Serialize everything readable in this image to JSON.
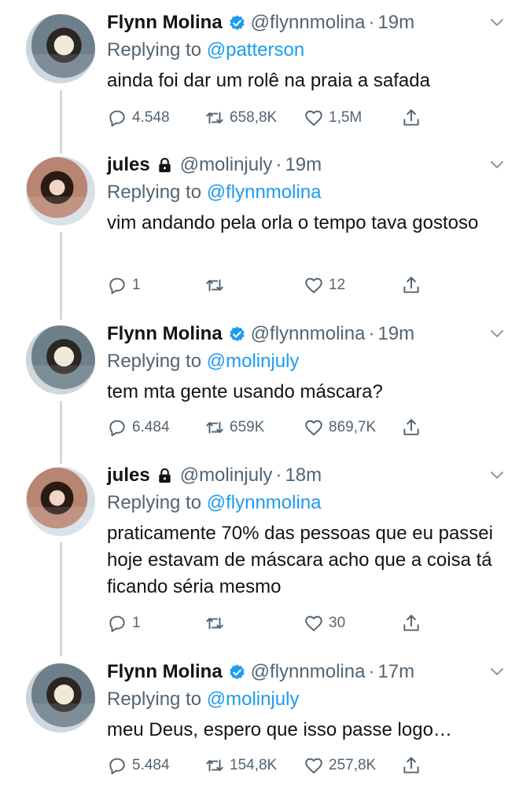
{
  "colors": {
    "accent": "#1d9bf0",
    "text_primary": "#0f1419",
    "text_secondary": "#536471",
    "thread_line": "#cfd9de"
  },
  "tweets": [
    {
      "author_name": "Flynn Molina",
      "verified": true,
      "locked": false,
      "handle": "@flynnmolina",
      "time": "19m",
      "reply_prefix": "Replying to ",
      "reply_to": "@patterson",
      "text": "ainda foi dar um rolê na praia a safada",
      "replies": "4.548",
      "retweets": "658,8K",
      "likes": "1,5M"
    },
    {
      "author_name": "jules",
      "verified": false,
      "locked": true,
      "handle": "@molinjuly",
      "time": "19m",
      "reply_prefix": "Replying to ",
      "reply_to": "@flynnmolina",
      "text": "vim andando pela orla o tempo tava gostoso",
      "replies": "1",
      "retweets": "",
      "likes": "12"
    },
    {
      "author_name": "Flynn Molina",
      "verified": true,
      "locked": false,
      "handle": "@flynnmolina",
      "time": "19m",
      "reply_prefix": "Replying to ",
      "reply_to": "@molinjuly",
      "text": "tem mta gente usando máscara?",
      "replies": "6.484",
      "retweets": "659K",
      "likes": "869,7K"
    },
    {
      "author_name": "jules",
      "verified": false,
      "locked": true,
      "handle": "@molinjuly",
      "time": "18m",
      "reply_prefix": "Replying to ",
      "reply_to": "@flynnmolina",
      "text": "praticamente 70% das pessoas que eu passei hoje estavam de máscara acho que a coisa tá ficando séria mesmo",
      "replies": "1",
      "retweets": "",
      "likes": "30"
    },
    {
      "author_name": "Flynn Molina",
      "verified": true,
      "locked": false,
      "handle": "@flynnmolina",
      "time": "17m",
      "reply_prefix": "Replying to ",
      "reply_to": "@molinjuly",
      "text": "meu Deus, espero que isso passe logo…",
      "replies": "5.484",
      "retweets": "154,8K",
      "likes": "257,8K"
    }
  ]
}
